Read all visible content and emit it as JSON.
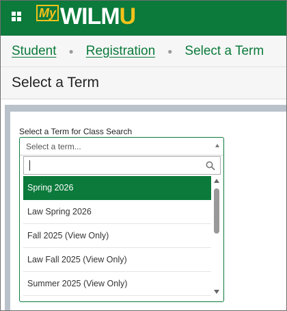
{
  "header": {
    "logo_my": "My",
    "logo_wilm": "WILM",
    "logo_u": "U",
    "menu_icon": "grid-menu-icon",
    "brand_color": "#0b7a3b",
    "accent_color": "#f4c21b"
  },
  "breadcrumb": {
    "items": [
      {
        "label": "Student",
        "link": true
      },
      {
        "label": "Registration",
        "link": true
      },
      {
        "label": "Select a Term",
        "link": false
      }
    ],
    "separator": "●"
  },
  "page": {
    "title": "Select a Term"
  },
  "term_select": {
    "label": "Select a Term for Class Search",
    "placeholder": "Select a term...",
    "search_value": "",
    "search_icon": "search-icon",
    "options": [
      {
        "label": "Spring 2026",
        "selected": true
      },
      {
        "label": "Law Spring 2026",
        "selected": false
      },
      {
        "label": "Fall 2025 (View Only)",
        "selected": false
      },
      {
        "label": "Law Fall 2025 (View Only)",
        "selected": false
      },
      {
        "label": "Summer 2025 (View Only)",
        "selected": false
      }
    ]
  }
}
